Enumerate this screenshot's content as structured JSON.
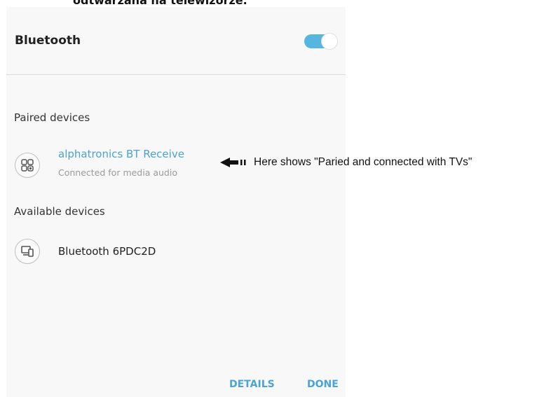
{
  "cropped_caption": "odtwarzana na telewizorze.",
  "bluetooth": {
    "title": "Bluetooth",
    "enabled": true,
    "accent_color": "#55b7e0"
  },
  "paired": {
    "section_title": "Paired devices",
    "devices": [
      {
        "name": "alphatronics BT Receive",
        "status": "Connected for media audio",
        "icon": "headset-bluetooth-icon",
        "name_color": "#4aa3d3"
      }
    ]
  },
  "available": {
    "section_title": "Available devices",
    "devices": [
      {
        "name": "Bluetooth 6PDC2D",
        "icon": "devices-icon"
      }
    ]
  },
  "footer": {
    "details_label": "DETAILS",
    "done_label": "DONE"
  },
  "annotation": {
    "text": "Here shows \"Paried and connected with TVs\"",
    "icon": "arrow-left-icon"
  }
}
